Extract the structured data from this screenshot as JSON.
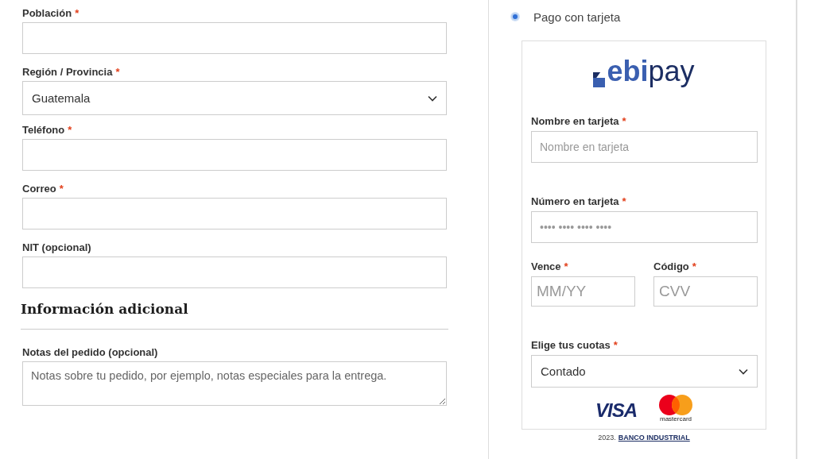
{
  "billing_fields": [
    {
      "kind": "input",
      "label": "Población",
      "required_mark": "*"
    },
    {
      "kind": "select",
      "label": "Región / Provincia",
      "required_mark": "*",
      "value": "Guatemala"
    },
    {
      "kind": "input",
      "label": "Teléfono",
      "required_mark": "*"
    },
    {
      "kind": "input",
      "label": "Correo",
      "required_mark": "*"
    },
    {
      "kind": "input",
      "label": "NIT (opcional)"
    }
  ],
  "additional": {
    "heading": "Información adicional",
    "notes": {
      "label": "Notas del pedido (opcional)",
      "placeholder": "Notas sobre tu pedido, por ejemplo, notas especiales para la entrega."
    }
  },
  "payment": {
    "option": {
      "label": "Pago con tarjeta",
      "selected": true
    },
    "logo": {
      "bold": "ebi",
      "light": "pay"
    },
    "fields": [
      {
        "kind": "wide",
        "label": "Nombre en tarjeta",
        "required_mark": "*",
        "placeholder": "Nombre en tarjeta"
      },
      {
        "kind": "wide",
        "label": "Número en tarjeta",
        "required_mark": "*",
        "placeholder": "•••• •••• •••• ••••"
      },
      {
        "kind": "half",
        "label": "Vence",
        "required_mark": "*",
        "placeholder": "MM/YY"
      },
      {
        "kind": "half",
        "label": "Código",
        "required_mark": "*",
        "placeholder": "CVV"
      },
      {
        "kind": "select",
        "label": "Elige tus cuotas",
        "required_mark": "*",
        "value": "Contado"
      }
    ],
    "card_brands": [
      {
        "kind": "visa",
        "text": "VISA"
      },
      {
        "kind": "mastercard",
        "text": "mastercard"
      }
    ],
    "footer": {
      "year": "2023.",
      "link": "BANCO INDUSTRIAL"
    }
  }
}
